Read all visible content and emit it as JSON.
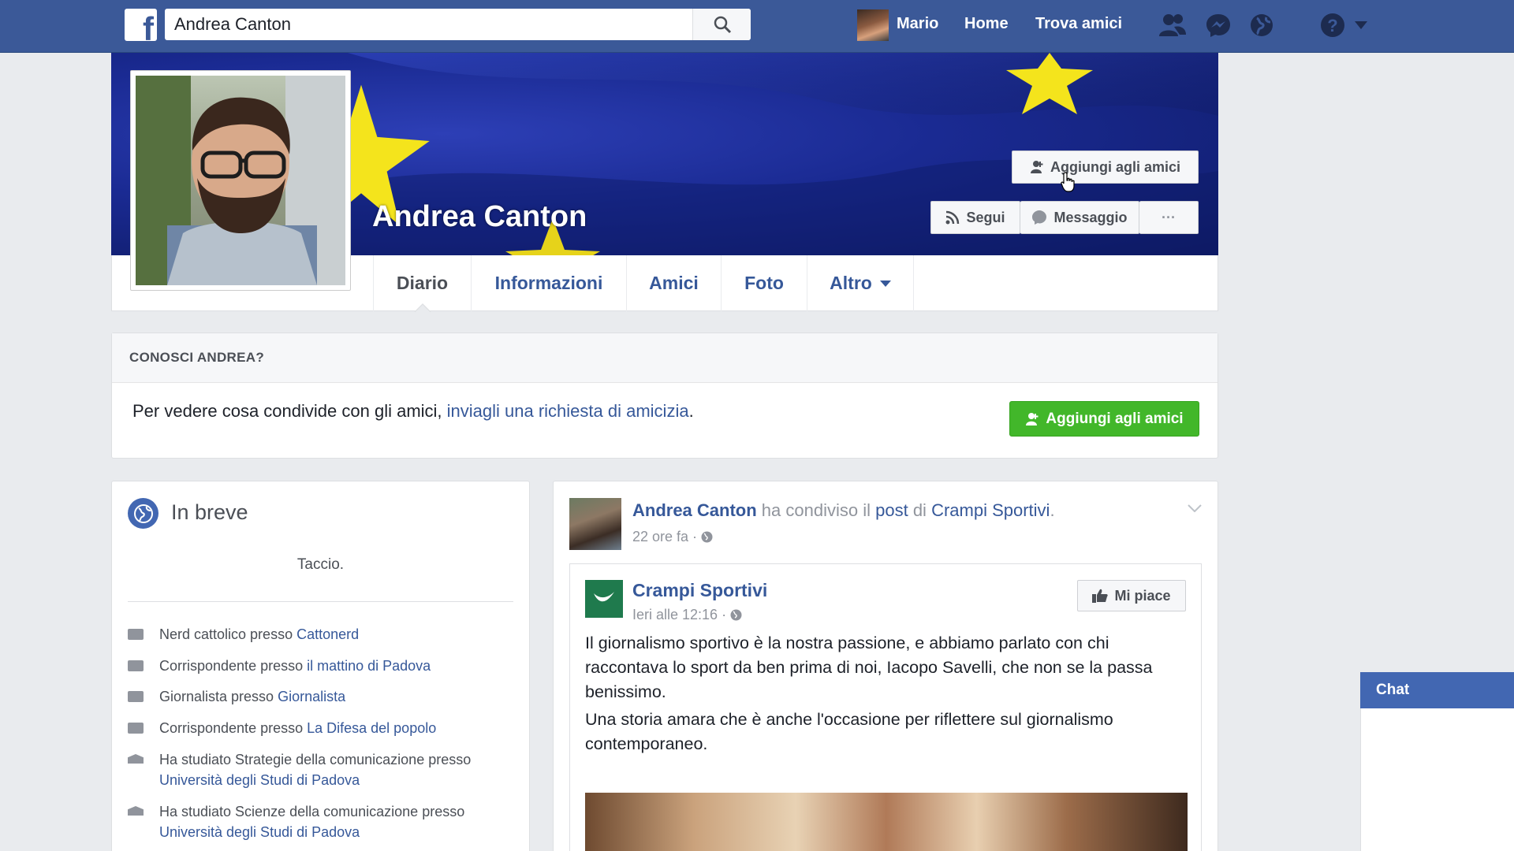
{
  "topbar": {
    "search_value": "Andrea Canton",
    "user_name": "Mario",
    "home_label": "Home",
    "find_friends_label": "Trova amici",
    "brand_color": "#3b5998",
    "icons": [
      "friend-requests-icon",
      "messenger-icon",
      "notifications-globe-icon",
      "help-icon",
      "account-menu-chevron-icon"
    ]
  },
  "profile": {
    "name": "Andrea Canton",
    "add_friend_label": "Aggiungi agli amici",
    "follow_label": "Segui",
    "message_label": "Messaggio",
    "more_label": "···"
  },
  "tabs": [
    {
      "label": "Diario"
    },
    {
      "label": "Informazioni"
    },
    {
      "label": "Amici"
    },
    {
      "label": "Foto"
    },
    {
      "label": "Altro"
    }
  ],
  "know_card": {
    "header": "CONOSCI ANDREA?",
    "text_before": "Per vedere cosa condivide con gli amici, ",
    "link_text": "inviagli una richiesta di amicizia",
    "text_after": ".",
    "button_label": "Aggiungi agli amici",
    "button_color": "#42b72a"
  },
  "intro": {
    "title": "In breve",
    "bio": "Taccio.",
    "items": [
      {
        "prefix": "Nerd cattolico presso ",
        "link": "Cattonerd",
        "icon": "work-icon"
      },
      {
        "prefix": "Corrispondente presso ",
        "link": "il mattino di Padova",
        "icon": "work-icon"
      },
      {
        "prefix": "Giornalista presso ",
        "link": "Giornalista",
        "icon": "work-icon"
      },
      {
        "prefix": "Corrispondente presso ",
        "link": "La Difesa del popolo",
        "icon": "work-icon"
      },
      {
        "prefix": "Ha studiato Strategie della comunicazione presso ",
        "link": "Università degli Studi di Padova",
        "icon": "school-icon"
      },
      {
        "prefix": "Ha studiato Scienze della comunicazione presso ",
        "link": "Università degli Studi di Padova",
        "icon": "school-icon"
      }
    ]
  },
  "post": {
    "author": "Andrea Canton",
    "action_text": " ha condiviso il ",
    "post_link": "post",
    "of_text": " di ",
    "page_link": "Crampi Sportivi",
    "end_text": ".",
    "time": "22 ore fa · ",
    "shared": {
      "page_name": "Crampi Sportivi",
      "time": "Ieri alle 12:16 · ",
      "like_label": "Mi piace",
      "paragraph1": "Il giornalismo sportivo è la nostra passione, e abbiamo parlato con chi raccontava lo sport da ben prima di noi, Iacopo Savelli, che non se la passa benissimo.",
      "paragraph2": "Una storia amara che è anche l'occasione per riflettere sul giornalismo contemporaneo."
    }
  },
  "chat": {
    "label": "Chat"
  }
}
